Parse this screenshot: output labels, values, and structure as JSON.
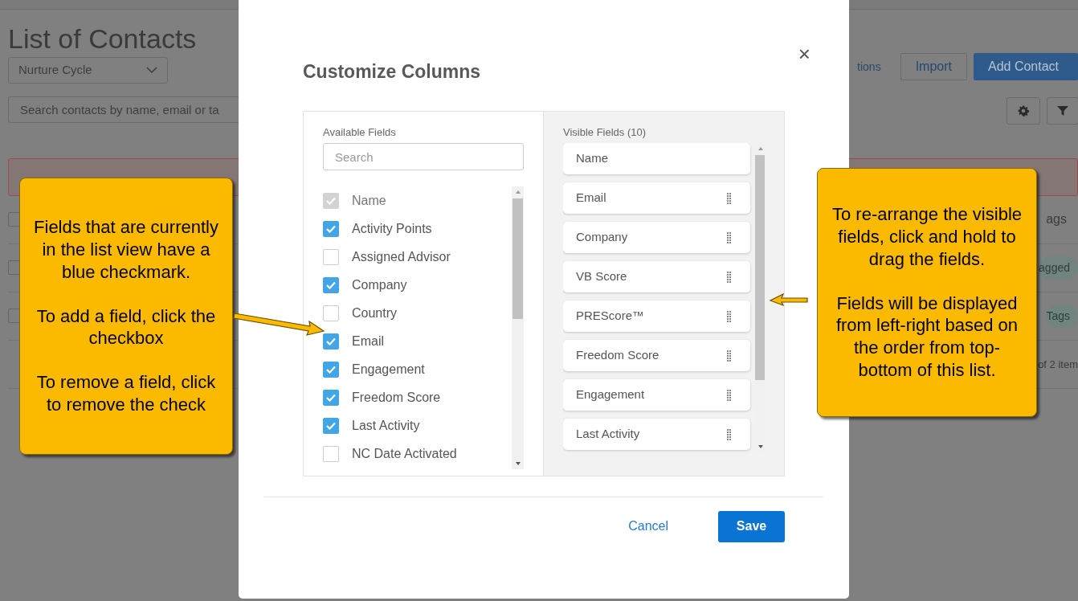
{
  "background_page": {
    "title": "List of Contacts",
    "filter_select": {
      "value": "Nurture Cycle"
    },
    "search": {
      "placeholder": "Search contacts by name, email or ta"
    },
    "header_link": "tions",
    "buttons": [
      {
        "label": "Import",
        "kind": "outline"
      },
      {
        "label": "Add Contact",
        "kind": "primary"
      }
    ],
    "table": {
      "header": "ags",
      "header_checked": false,
      "rows": [
        {
          "tag": "agged",
          "checked": false
        },
        {
          "tag": "Tags",
          "checked": false
        }
      ],
      "footer": "of 2 item"
    }
  },
  "modal": {
    "title": "Customize Columns",
    "close": "×",
    "available_fields": {
      "label": "Available Fields",
      "search": {
        "placeholder": "Search"
      },
      "items": [
        {
          "label": "Name",
          "checked": true,
          "disabled": true
        },
        {
          "label": "Activity Points",
          "checked": true,
          "disabled": false
        },
        {
          "label": "Assigned Advisor",
          "checked": false,
          "disabled": false
        },
        {
          "label": "Company",
          "checked": true,
          "disabled": false
        },
        {
          "label": "Country",
          "checked": false,
          "disabled": false
        },
        {
          "label": "Email",
          "checked": true,
          "disabled": false
        },
        {
          "label": "Engagement",
          "checked": true,
          "disabled": false
        },
        {
          "label": "Freedom Score",
          "checked": true,
          "disabled": false
        },
        {
          "label": "Last Activity",
          "checked": true,
          "disabled": false
        },
        {
          "label": "NC Date Activated",
          "checked": false,
          "disabled": false
        }
      ]
    },
    "visible_fields": {
      "label": "Visible Fields (10)",
      "items": [
        {
          "label": "Name",
          "draggable": false
        },
        {
          "label": "Email",
          "draggable": true
        },
        {
          "label": "Company",
          "draggable": true
        },
        {
          "label": "VB Score",
          "draggable": true
        },
        {
          "label": "PREScore™",
          "draggable": true
        },
        {
          "label": "Freedom Score",
          "draggable": true
        },
        {
          "label": "Engagement",
          "draggable": true
        },
        {
          "label": "Last Activity",
          "draggable": true
        }
      ]
    },
    "buttons": [
      {
        "label": "Cancel",
        "kind": "link"
      },
      {
        "label": "Save",
        "kind": "primary"
      }
    ]
  },
  "callouts": [
    {
      "paragraphs": [
        "Fields that are currently in the list view have a blue checkmark.",
        "To add a field, click the checkbox",
        "To remove a field, click to remove the check"
      ]
    },
    {
      "paragraphs": [
        "To re-arrange the visible fields, click and hold to drag the fields.",
        "Fields will be displayed from left-right based on the order from top-bottom of this list."
      ]
    }
  ]
}
